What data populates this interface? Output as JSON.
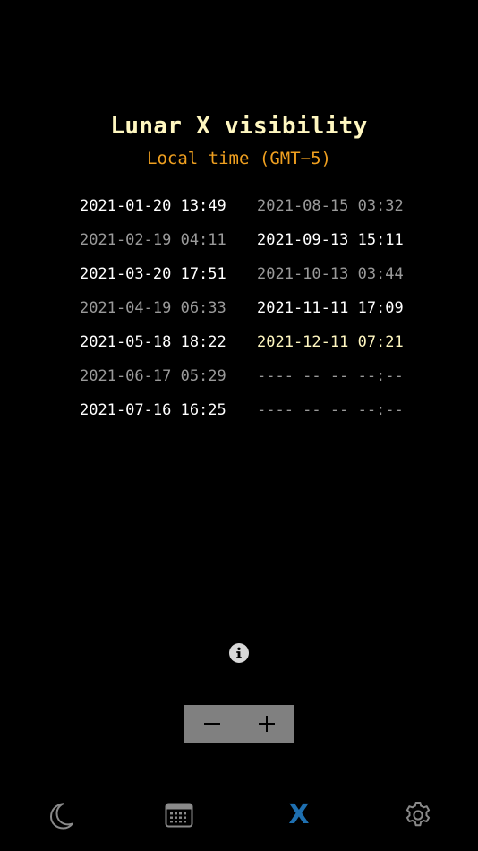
{
  "header": {
    "title": "Lunar X visibility",
    "subtitle": "Local time (GMT−5)"
  },
  "dates": {
    "left": [
      {
        "text": "2021-01-20 13:49",
        "style": "bright"
      },
      {
        "text": "2021-02-19 04:11",
        "style": "dim"
      },
      {
        "text": "2021-03-20 17:51",
        "style": "bright"
      },
      {
        "text": "2021-04-19 06:33",
        "style": "dim"
      },
      {
        "text": "2021-05-18 18:22",
        "style": "bright"
      },
      {
        "text": "2021-06-17 05:29",
        "style": "dim"
      },
      {
        "text": "2021-07-16 16:25",
        "style": "bright"
      }
    ],
    "right": [
      {
        "text": "2021-08-15 03:32",
        "style": "dim"
      },
      {
        "text": "2021-09-13 15:11",
        "style": "bright"
      },
      {
        "text": "2021-10-13 03:44",
        "style": "dim"
      },
      {
        "text": "2021-11-11 17:09",
        "style": "bright"
      },
      {
        "text": "2021-12-11 07:21",
        "style": "next"
      },
      {
        "text": "---- -- -- --:--",
        "style": "empty"
      },
      {
        "text": "---- -- -- --:--",
        "style": "empty"
      }
    ]
  },
  "info": {
    "icon": "info-icon"
  },
  "stepper": {
    "minus_icon": "minus-icon",
    "plus_icon": "plus-icon",
    "background": "#808080"
  },
  "tabbar": {
    "tabs": [
      {
        "id": "moon",
        "icon": "moon-icon",
        "active": false
      },
      {
        "id": "calendar",
        "icon": "calendar-icon",
        "active": false
      },
      {
        "id": "lunar-x",
        "icon": "lunar-x-icon",
        "label": "X",
        "active": true
      },
      {
        "id": "settings",
        "icon": "gear-icon",
        "active": false
      }
    ]
  },
  "colors": {
    "background": "#000000",
    "title": "#fff7c0",
    "subtitle": "#f0a020",
    "bright": "#ffffff",
    "dim": "#9a9a9a",
    "next": "#fff7c0",
    "active_tab": "#1e6fb0",
    "inactive_tab": "#8a8a8a"
  }
}
